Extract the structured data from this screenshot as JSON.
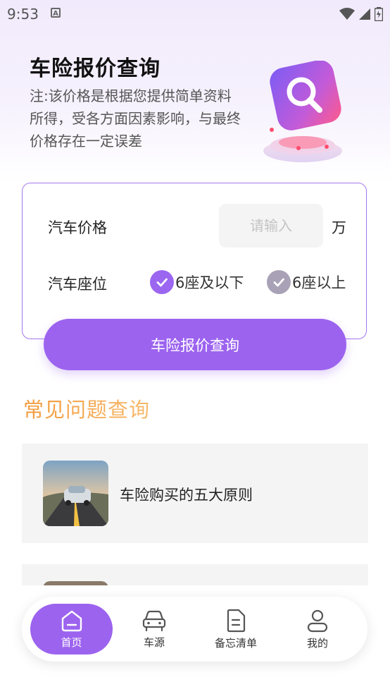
{
  "status": {
    "time": "9:53"
  },
  "header": {
    "title": "车险报价查询",
    "note": "注:该价格是根据您提供简单资料所得，受各方面因素影响，与最终价格存在一定误差"
  },
  "form": {
    "price_label": "汽车价格",
    "price_placeholder": "请输入",
    "price_value": "",
    "price_unit": "万",
    "seat_label": "汽车座位",
    "seat_options": [
      "6座及以下",
      "6座以上"
    ],
    "seat_selected": "6座及以下",
    "submit_label": "车险报价查询"
  },
  "faq": {
    "title": "常见问题查询",
    "items": [
      {
        "title": "车险购买的五大原则"
      }
    ]
  },
  "tabbar": {
    "items": [
      {
        "label": "首页",
        "icon": "home-icon",
        "active": true
      },
      {
        "label": "车源",
        "icon": "car-icon",
        "active": false
      },
      {
        "label": "备忘清单",
        "icon": "document-icon",
        "active": false
      },
      {
        "label": "我的",
        "icon": "user-icon",
        "active": false
      }
    ]
  },
  "colors": {
    "accent": "#9c63ef",
    "faq_title_gradient": [
      "#f29a3d",
      "#f7b96b"
    ],
    "card_border": "#a478ee"
  }
}
